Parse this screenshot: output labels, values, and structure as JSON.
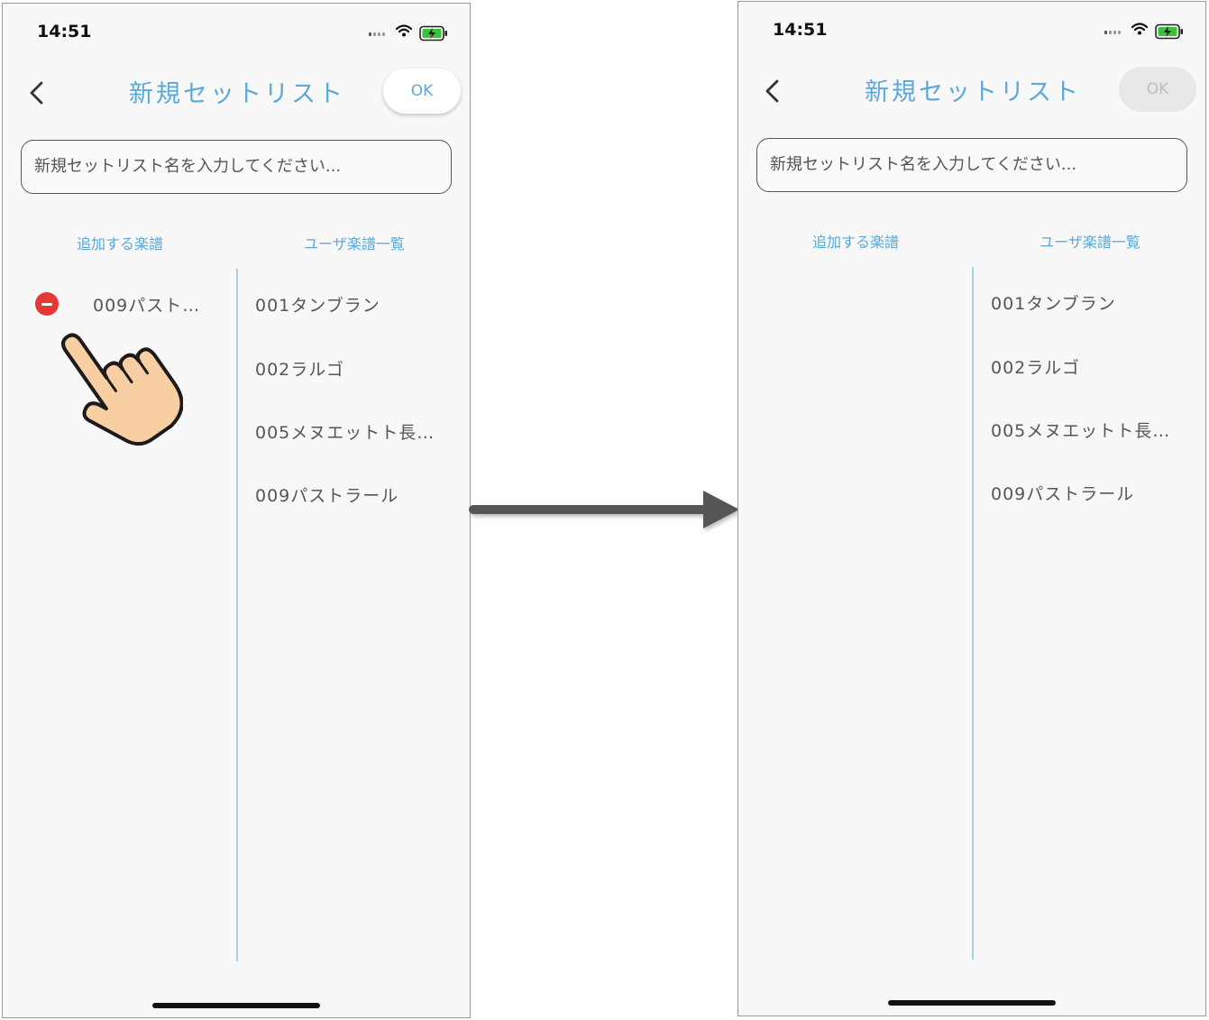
{
  "before": {
    "status": {
      "time": "14:51"
    },
    "nav": {
      "title": "新規セットリスト",
      "ok_label": "OK"
    },
    "input": {
      "placeholder": "新規セットリスト名を入力してください..."
    },
    "columns": {
      "added_header": "追加する楽譜",
      "user_header": "ユーザ楽譜一覧"
    },
    "added_songs": [
      "009パスト…"
    ],
    "user_songs": [
      "001タンブラン",
      "002ラルゴ",
      "005メヌエットト長…",
      "009パストラール"
    ]
  },
  "after": {
    "status": {
      "time": "14:51"
    },
    "nav": {
      "title": "新規セットリスト",
      "ok_label": "OK"
    },
    "input": {
      "placeholder": "新規セットリスト名を入力してください..."
    },
    "columns": {
      "added_header": "追加する楽譜",
      "user_header": "ユーザ楽譜一覧"
    },
    "user_songs": [
      "001タンブラン",
      "002ラルゴ",
      "005メヌエットト長…",
      "009パストラール"
    ]
  },
  "icons": {
    "remove": "minus-circle-icon",
    "pointer": "hand-pointer-icon",
    "transition": "right-arrow-icon"
  },
  "colors": {
    "accent": "#5aa9d8",
    "remove": "#e53935",
    "divider": "#a8cfe8",
    "ok_disabled_bg": "#e8e8e8"
  }
}
